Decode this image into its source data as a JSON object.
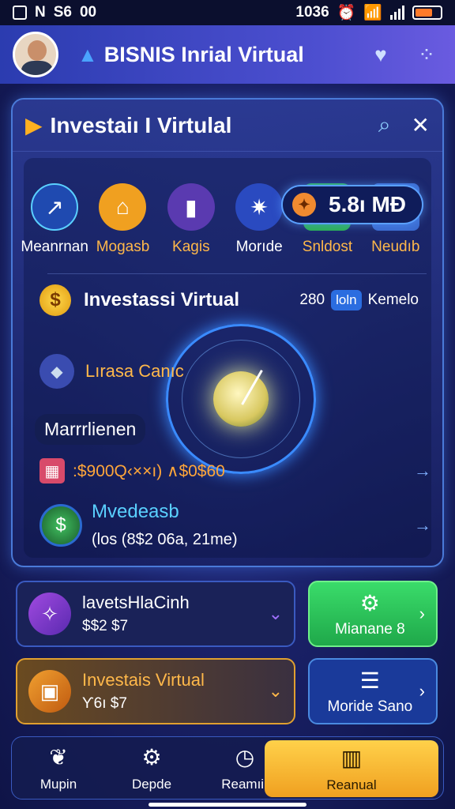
{
  "status_bar": {
    "left_a": "N",
    "left_b": "S6",
    "left_c": "00",
    "time": "1036",
    "battery_level": 0.7
  },
  "header": {
    "title": "BISNIS Inrial Virtual"
  },
  "panel": {
    "title": "Investaiı I Virtulal"
  },
  "menu": [
    {
      "label": "Meanrnan",
      "icon": "chart-icon",
      "color": "#ffffff"
    },
    {
      "label": "Mogasb",
      "icon": "bag-icon",
      "color": "#ffb84a"
    },
    {
      "label": "Kagis",
      "icon": "bar-chart-icon",
      "color": "#ffb84a"
    },
    {
      "label": "Morıde",
      "icon": "globe-icon",
      "color": "#ffffff"
    },
    {
      "label": "Snldost",
      "icon": "shield-icon",
      "color": "#ffb84a"
    },
    {
      "label": "Neudıb",
      "icon": "document-icon",
      "color": "#ffb84a"
    }
  ],
  "invest": {
    "title": "Investassi Virtual",
    "meta_num": "280",
    "meta_badge": "loln",
    "meta_text": "Kemelo",
    "coin_symbol": "$"
  },
  "liras": {
    "label": "Lırasa Canıc"
  },
  "value_pill": {
    "text": "5.8ı MĐ"
  },
  "tag": {
    "label": "Marrrlienen"
  },
  "rate": {
    "text": ":$900Q‹××ı) ∧$0$60"
  },
  "mv": {
    "title": "Mvedeasb",
    "subtitle": "(los (8$2 06a, 21me)"
  },
  "cards": {
    "a_title": "lavetsHlaCinh",
    "a_sub": "$$2 $7",
    "b_label": "Mianane 8",
    "c_title": "Investais Virtual",
    "c_sub": "Ƴ6ı $7",
    "d_label": "Moride Sano"
  },
  "bottom_nav": [
    {
      "label": "Mupin",
      "icon": "dog-icon"
    },
    {
      "label": "Depde",
      "icon": "gear-icon"
    },
    {
      "label": "Reamıir",
      "icon": "clock-icon"
    },
    {
      "label": "Reanual",
      "icon": "book-icon"
    }
  ]
}
